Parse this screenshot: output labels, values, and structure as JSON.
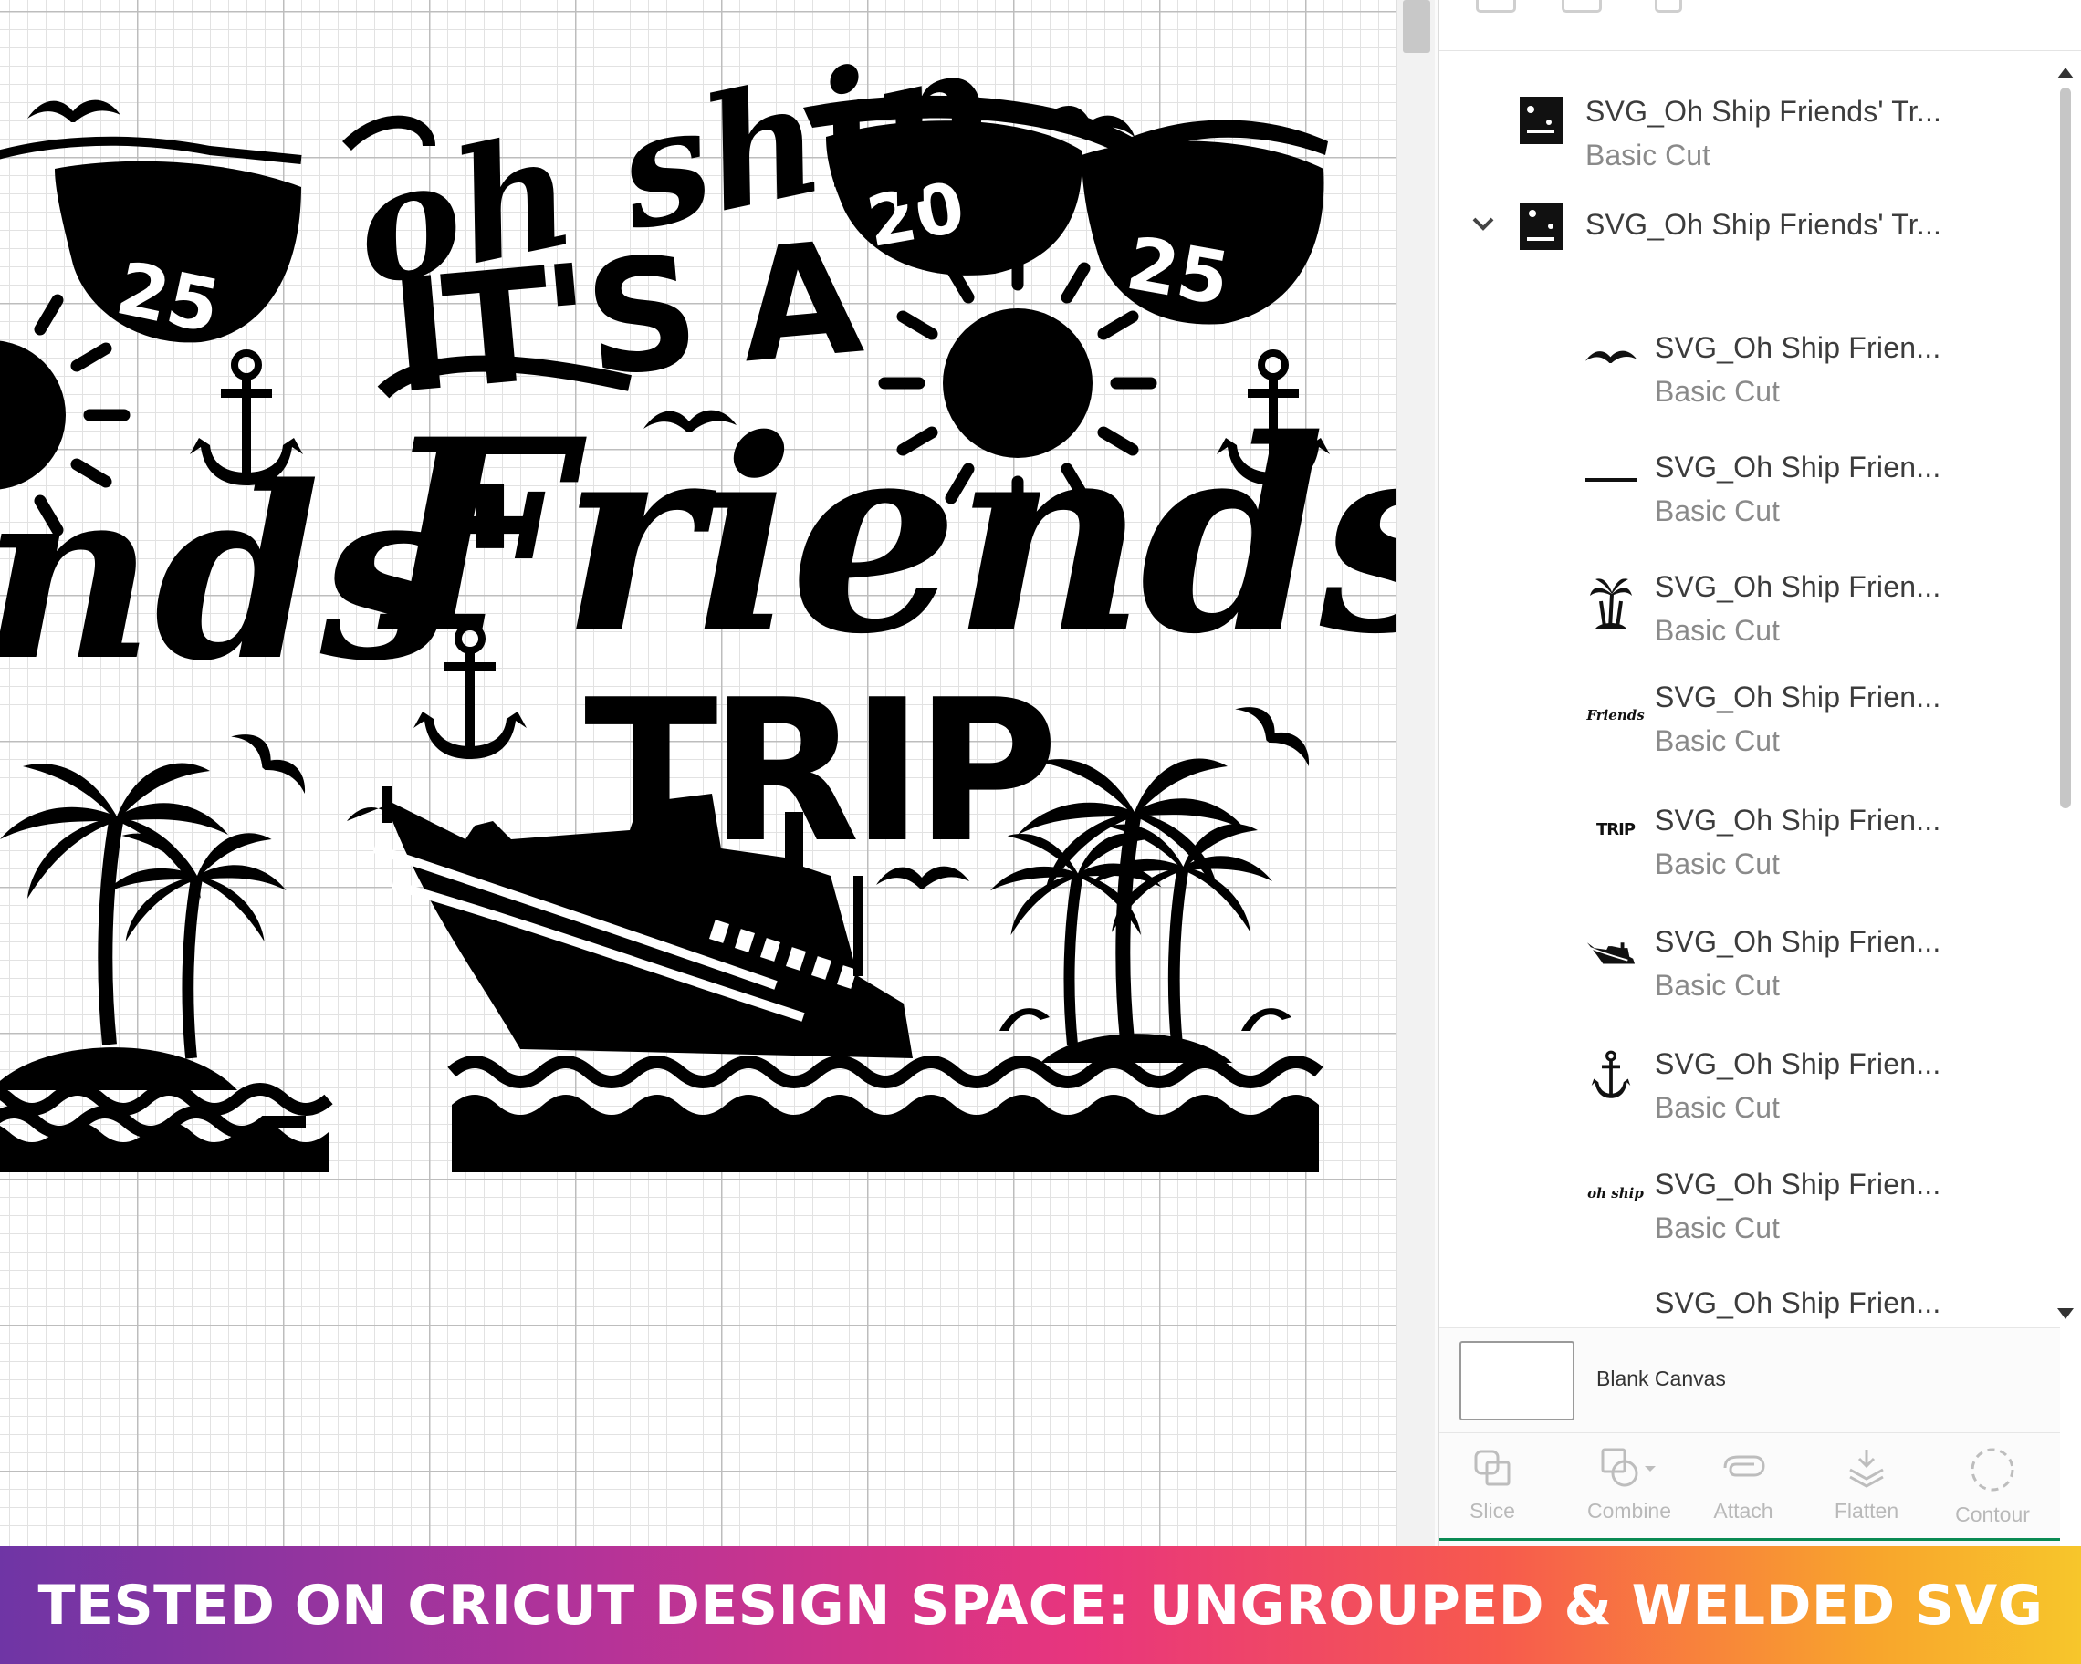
{
  "design": {
    "year_left": "20",
    "year_right": "25",
    "year_partial": "25",
    "phrase_oh_ship": "oh ship",
    "phrase_its_a": "IT'S A",
    "phrase_friends": "Friends'",
    "phrase_trip": "TRIP",
    "partial_friends": "nds'"
  },
  "layers_panel": {
    "items": [
      {
        "name": "SVG_Oh Ship Friends' Tr...",
        "operation": "Basic Cut",
        "thumb_icon": "design-thumbnail-icon"
      },
      {
        "name": "SVG_Oh Ship Friends' Tr...",
        "operation": "",
        "thumb_icon": "design-thumbnail-icon",
        "expanded": true
      },
      {
        "name": "SVG_Oh Ship Frien...",
        "operation": "Basic Cut",
        "thumb_icon": "seagull-icon"
      },
      {
        "name": "SVG_Oh Ship Frien...",
        "operation": "Basic Cut",
        "thumb_icon": "line-icon"
      },
      {
        "name": "SVG_Oh Ship Frien...",
        "operation": "Basic Cut",
        "thumb_icon": "palm-tree-icon"
      },
      {
        "name": "SVG_Oh Ship Frien...",
        "operation": "Basic Cut",
        "thumb_icon": "friends-text-icon"
      },
      {
        "name": "SVG_Oh Ship Frien...",
        "operation": "Basic Cut",
        "thumb_icon": "trip-text-icon"
      },
      {
        "name": "SVG_Oh Ship Frien...",
        "operation": "Basic Cut",
        "thumb_icon": "ship-icon"
      },
      {
        "name": "SVG_Oh Ship Frien...",
        "operation": "Basic Cut",
        "thumb_icon": "anchor-icon"
      },
      {
        "name": "SVG_Oh Ship Frien...",
        "operation": "Basic Cut",
        "thumb_icon": "oh-ship-text-icon"
      },
      {
        "name": "SVG_Oh Ship Frien...",
        "operation": "",
        "thumb_icon": ""
      }
    ],
    "thumb_text": {
      "friends": "Friends",
      "trip": "TRIP",
      "oh_ship": "oh ship"
    },
    "blank_canvas_label": "Blank Canvas"
  },
  "toolbar": {
    "slice": "Slice",
    "combine": "Combine",
    "attach": "Attach",
    "flatten": "Flatten",
    "contour": "Contour"
  },
  "banner": {
    "text": "TESTED ON CRICUT DESIGN SPACE: UNGROUPED & WELDED SVG"
  },
  "colors": {
    "design_black": "#000000",
    "grid_major": "#bdbdbd",
    "grid_minor": "#e2e2e2",
    "toolbar_accent": "#0a8a53",
    "banner_gradient": [
      "#6f35a5",
      "#b1339a",
      "#e8357d",
      "#f75a4d",
      "#f8a52c",
      "#f7c62b"
    ]
  }
}
